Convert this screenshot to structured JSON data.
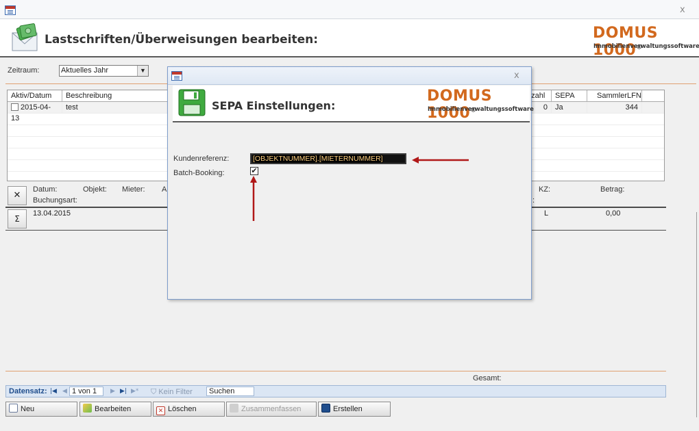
{
  "window": {
    "title_icon": "form-icon",
    "close_label": "x"
  },
  "header": {
    "title": "Lastschriften/Überweisungen bearbeiten:",
    "logo_brand": "DOMUS 1000",
    "logo_reg": "®",
    "logo_sub": "Immobilienverwaltungssoftware",
    "icon": "money-envelope-icon"
  },
  "filter": {
    "label": "Zeitraum:",
    "value": "Aktuelles Jahr"
  },
  "grid": {
    "columns_left": [
      "Aktiv/Datum",
      "Beschreibung"
    ],
    "columns_right": [
      "nzahl",
      "SEPA",
      "SammlerLFN"
    ],
    "rows": [
      {
        "active": false,
        "date": "2015-04-13",
        "description": "test",
        "anzahl": "0",
        "sepa": "Ja",
        "sammler": "344"
      }
    ]
  },
  "detail": {
    "labels": [
      "Datum:",
      "Objekt:",
      "Mieter:",
      "A",
      "KZ:",
      "Betrag:",
      "Buchungsart:",
      ":"
    ],
    "row": {
      "datum": "13.04.2015",
      "kz": "L",
      "betrag": "0,00"
    }
  },
  "footer": {
    "gesamt_label": "Gesamt:",
    "nav": {
      "label": "Datensatz:",
      "record": "1 von 1",
      "filter_label": "Kein Filter",
      "search_label": "Suchen"
    },
    "buttons": [
      {
        "label": "Neu",
        "icon": "new-document-icon",
        "enabled": true
      },
      {
        "label": "Bearbeiten",
        "icon": "edit-icon",
        "enabled": true
      },
      {
        "label": "Löschen",
        "icon": "delete-icon",
        "enabled": true
      },
      {
        "label": "Zusammenfassen",
        "icon": "merge-icon",
        "enabled": false
      },
      {
        "label": "Erstellen",
        "icon": "save-icon",
        "enabled": true
      }
    ]
  },
  "dialog": {
    "close_label": "x",
    "title": "SEPA Einstellungen:",
    "icon": "floppy-disk-icon",
    "logo_brand": "DOMUS 1000",
    "logo_reg": "®",
    "logo_sub": "Immobilienverwaltungssoftware",
    "kundenreferenz_label": "Kundenreferenz:",
    "kundenreferenz_value": "[OBJEKTNUMMER].[MIETERNUMMER]",
    "batch_label": "Batch-Booking:",
    "batch_checked": true
  },
  "colors": {
    "logo_orange": "#d2691e",
    "annotation_arrow": "#b01818",
    "nav_blue": "#1f4d8c"
  }
}
